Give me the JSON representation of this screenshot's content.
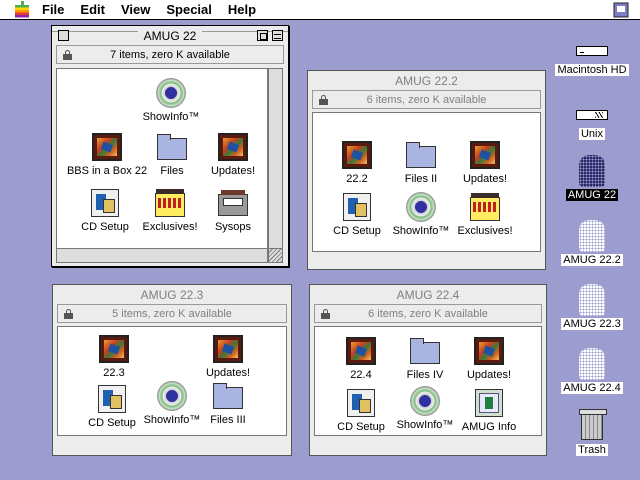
{
  "menubar": {
    "items": [
      "File",
      "Edit",
      "View",
      "Special",
      "Help"
    ]
  },
  "windows": [
    {
      "title": "AMUG 22",
      "info": "7 items, zero K available",
      "icons": [
        {
          "label": "ShowInfo™",
          "type": "cd"
        },
        {
          "label": "BBS in a Box 22",
          "type": "picture"
        },
        {
          "label": "Files",
          "type": "folder"
        },
        {
          "label": "Updates!",
          "type": "picture"
        },
        {
          "label": "CD Setup",
          "type": "setup"
        },
        {
          "label": "Exclusives!",
          "type": "exclusive"
        },
        {
          "label": "Sysops",
          "type": "box"
        }
      ]
    },
    {
      "title": "AMUG 22.2",
      "info": "6 items, zero K available",
      "icons": [
        {
          "label": "22.2",
          "type": "picture"
        },
        {
          "label": "Files II",
          "type": "folder"
        },
        {
          "label": "Updates!",
          "type": "picture"
        },
        {
          "label": "CD Setup",
          "type": "setup"
        },
        {
          "label": "ShowInfo™",
          "type": "cd"
        },
        {
          "label": "Exclusives!",
          "type": "exclusive"
        }
      ]
    },
    {
      "title": "AMUG 22.3",
      "info": "5 items, zero K available",
      "icons": [
        {
          "label": "22.3",
          "type": "picture"
        },
        {
          "label": "Updates!",
          "type": "picture"
        },
        {
          "label": "CD Setup",
          "type": "setup"
        },
        {
          "label": "ShowInfo™",
          "type": "cd"
        },
        {
          "label": "Files III",
          "type": "folder"
        }
      ]
    },
    {
      "title": "AMUG 22.4",
      "info": "6 items, zero K available",
      "icons": [
        {
          "label": "22.4",
          "type": "picture"
        },
        {
          "label": "Files IV",
          "type": "folder"
        },
        {
          "label": "Updates!",
          "type": "picture"
        },
        {
          "label": "CD Setup",
          "type": "setup"
        },
        {
          "label": "ShowInfo™",
          "type": "cd"
        },
        {
          "label": "AMUG Info",
          "type": "info"
        }
      ]
    }
  ],
  "desktop": [
    {
      "label": "Macintosh HD",
      "type": "hd",
      "selected": false
    },
    {
      "label": "Unix",
      "type": "unix",
      "selected": false
    },
    {
      "label": "AMUG 22",
      "type": "cdrom-dark",
      "selected": true
    },
    {
      "label": "AMUG 22.2",
      "type": "cdrom",
      "selected": false
    },
    {
      "label": "AMUG 22.3",
      "type": "cdrom",
      "selected": false
    },
    {
      "label": "AMUG 22.4",
      "type": "cdrom",
      "selected": false
    },
    {
      "label": "Trash",
      "type": "trash",
      "selected": false
    }
  ],
  "colors": {
    "desktop": "#9c9cce",
    "window": "#ececec"
  }
}
